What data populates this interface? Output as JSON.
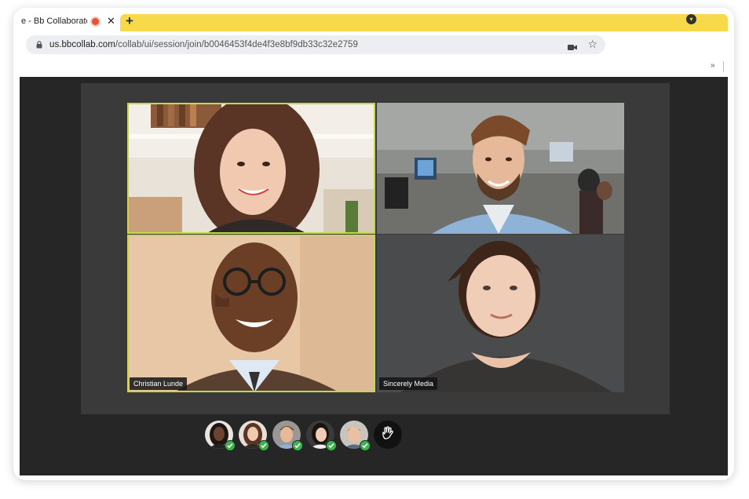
{
  "browser": {
    "tab_title": "e - Bb Collaborate",
    "tab_close": "✕",
    "new_tab": "+",
    "url_host": "us.bbcollab.com",
    "url_path": "/collab/ui/session/join/b0046453f4de4f3e8bf9db33c32e2759",
    "more_bookmarks": "»"
  },
  "session": {
    "tiles": [
      {
        "name": "",
        "speaking": true
      },
      {
        "name": "",
        "speaking": false
      },
      {
        "name": "Christian Lunde",
        "speaking": true
      },
      {
        "name": "Sincerely Media",
        "speaking": false
      }
    ],
    "participants_count": 5,
    "colors": {
      "accent": "#c4d84a",
      "check": "#3cb44b",
      "tab_ribbon": "#f8d94a"
    }
  }
}
